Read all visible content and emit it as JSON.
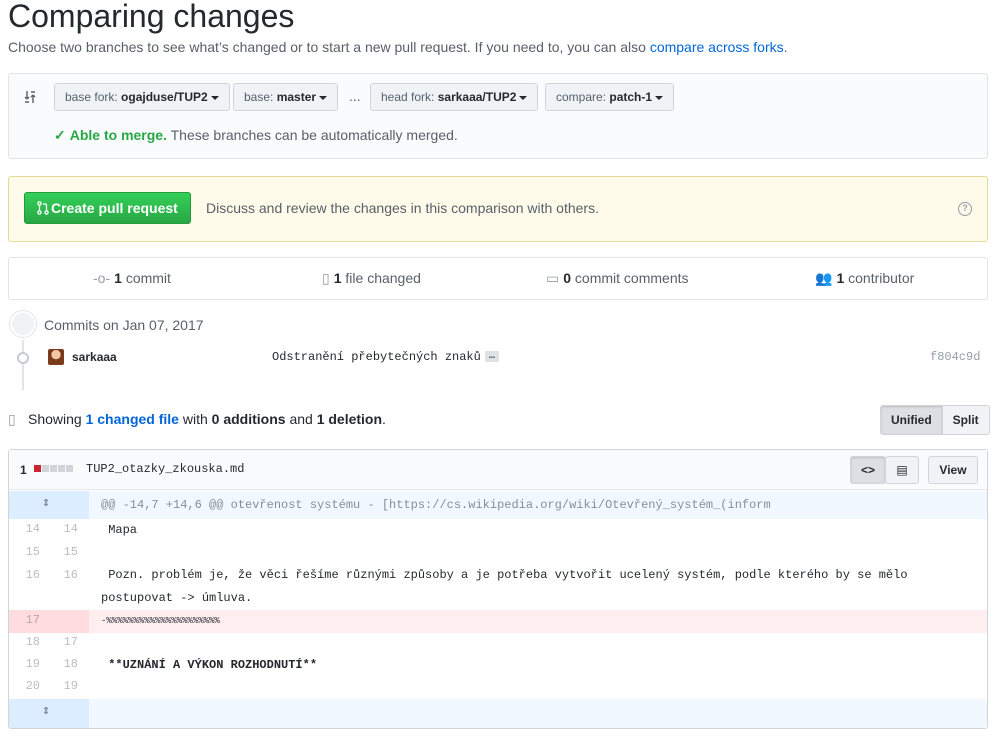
{
  "page": {
    "title": "Comparing changes",
    "subtitle": "Choose two branches to see what’s changed or to start a new pull request. If you need to, you can also",
    "subtitle_link": "compare across forks",
    "subtitle_end": "."
  },
  "range": {
    "base_fork_label": "base fork:",
    "base_fork_value": "ogajduse/TUP2",
    "base_label": "base:",
    "base_value": "master",
    "ellipsis": "...",
    "head_fork_label": "head fork:",
    "head_fork_value": "sarkaaa/TUP2",
    "compare_label": "compare:",
    "compare_value": "patch-1",
    "merge_status_bold": "Able to merge.",
    "merge_status_text": "These branches can be automatically merged."
  },
  "pull_request": {
    "button_label": "Create pull request",
    "description": "Discuss and review the changes in this comparison with others.",
    "help_icon": "?"
  },
  "stats": {
    "commits_count": "1",
    "commits_label": "commit",
    "files_count": "1",
    "files_label": "file changed",
    "comments_count": "0",
    "comments_label": "commit comments",
    "contributors_count": "1",
    "contributors_label": "contributor"
  },
  "commits": {
    "heading": "Commits on Jan 07, 2017",
    "items": [
      {
        "author": "sarkaaa",
        "message": "Odstranění přebytečných znaků",
        "expander": "…",
        "sha": "f804c9d"
      }
    ]
  },
  "summary": {
    "prefix": "Showing",
    "changed_files": "1 changed file",
    "with": "with",
    "additions": "0 additions",
    "and": "and",
    "deletions": "1 deletion",
    "end": ".",
    "view_unified": "Unified",
    "view_split": "Split"
  },
  "file": {
    "count": "1",
    "name": "TUP2_otazky_zkouska.md",
    "view_button": "View",
    "hunk_header": "@@ -14,7 +14,6 @@ otevřenost systému - [https://cs.wikipedia.org/wiki/Otevřený_systém_(inform",
    "lines": [
      {
        "old": "14",
        "new": "14",
        "text": " Mapa"
      },
      {
        "old": "15",
        "new": "15",
        "text": ""
      },
      {
        "old": "16",
        "new": "16",
        "text": " Pozn. problém je, že věci řešíme různými způsoby a je potřeba vytvořit ucelený systém, podle kterého by se mělo postupovat -> úmluva."
      },
      {
        "old": "17",
        "new": "",
        "text": "-%%%%%%%%%%%%%%%%%%%%%"
      },
      {
        "old": "18",
        "new": "17",
        "text": ""
      },
      {
        "old": "19",
        "new": "18",
        "text": " **UZNÁNÍ A VÝKON ROZHODNUTÍ**"
      },
      {
        "old": "20",
        "new": "19",
        "text": ""
      }
    ]
  },
  "colors": {
    "accent": "#0366d6",
    "success": "#28a745",
    "deletion": "#cb2431"
  }
}
